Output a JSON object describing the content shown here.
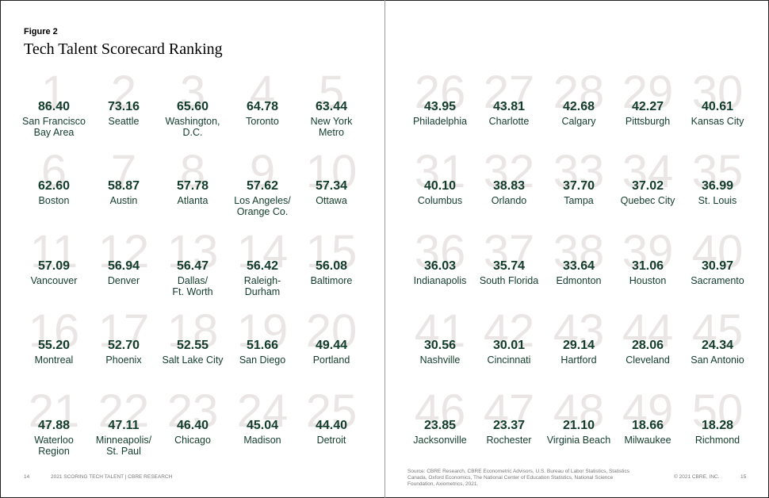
{
  "figure": {
    "label": "Figure 2",
    "title": "Tech Talent Scorecard Ranking"
  },
  "left_page": [
    {
      "rank": "1",
      "score": "86.40",
      "city": [
        "San Francisco",
        "Bay Area"
      ]
    },
    {
      "rank": "2",
      "score": "73.16",
      "city": [
        "Seattle"
      ]
    },
    {
      "rank": "3",
      "score": "65.60",
      "city": [
        "Washington,",
        "D.C."
      ]
    },
    {
      "rank": "4",
      "score": "64.78",
      "city": [
        "Toronto"
      ]
    },
    {
      "rank": "5",
      "score": "63.44",
      "city": [
        "New York Metro"
      ]
    },
    {
      "rank": "6",
      "score": "62.60",
      "city": [
        "Boston"
      ]
    },
    {
      "rank": "7",
      "score": "58.87",
      "city": [
        "Austin"
      ]
    },
    {
      "rank": "8",
      "score": "57.78",
      "city": [
        "Atlanta"
      ]
    },
    {
      "rank": "9",
      "score": "57.62",
      "city": [
        "Los Angeles/",
        "Orange Co."
      ]
    },
    {
      "rank": "10",
      "score": "57.34",
      "city": [
        "Ottawa"
      ]
    },
    {
      "rank": "11",
      "score": "57.09",
      "city": [
        "Vancouver"
      ]
    },
    {
      "rank": "12",
      "score": "56.94",
      "city": [
        "Denver"
      ]
    },
    {
      "rank": "13",
      "score": "56.47",
      "city": [
        "Dallas/",
        "Ft. Worth"
      ]
    },
    {
      "rank": "14",
      "score": "56.42",
      "city": [
        "Raleigh-Durham"
      ]
    },
    {
      "rank": "15",
      "score": "56.08",
      "city": [
        "Baltimore"
      ]
    },
    {
      "rank": "16",
      "score": "55.20",
      "city": [
        "Montreal"
      ]
    },
    {
      "rank": "17",
      "score": "52.70",
      "city": [
        "Phoenix"
      ]
    },
    {
      "rank": "18",
      "score": "52.55",
      "city": [
        "Salt Lake City"
      ]
    },
    {
      "rank": "19",
      "score": "51.66",
      "city": [
        "San Diego"
      ]
    },
    {
      "rank": "20",
      "score": "49.44",
      "city": [
        "Portland"
      ]
    },
    {
      "rank": "21",
      "score": "47.88",
      "city": [
        "Waterloo",
        "Region"
      ]
    },
    {
      "rank": "22",
      "score": "47.11",
      "city": [
        "Minneapolis/",
        "St. Paul"
      ]
    },
    {
      "rank": "23",
      "score": "46.40",
      "city": [
        "Chicago"
      ]
    },
    {
      "rank": "24",
      "score": "45.04",
      "city": [
        "Madison"
      ]
    },
    {
      "rank": "25",
      "score": "44.40",
      "city": [
        "Detroit"
      ]
    }
  ],
  "right_page": [
    {
      "rank": "26",
      "score": "43.95",
      "city": [
        "Philadelphia"
      ]
    },
    {
      "rank": "27",
      "score": "43.81",
      "city": [
        "Charlotte"
      ]
    },
    {
      "rank": "28",
      "score": "42.68",
      "city": [
        "Calgary"
      ]
    },
    {
      "rank": "29",
      "score": "42.27",
      "city": [
        "Pittsburgh"
      ]
    },
    {
      "rank": "30",
      "score": "40.61",
      "city": [
        "Kansas City"
      ]
    },
    {
      "rank": "31",
      "score": "40.10",
      "city": [
        "Columbus"
      ]
    },
    {
      "rank": "32",
      "score": "38.83",
      "city": [
        "Orlando"
      ]
    },
    {
      "rank": "33",
      "score": "37.70",
      "city": [
        "Tampa"
      ]
    },
    {
      "rank": "34",
      "score": "37.02",
      "city": [
        "Quebec City"
      ]
    },
    {
      "rank": "35",
      "score": "36.99",
      "city": [
        "St. Louis"
      ]
    },
    {
      "rank": "36",
      "score": "36.03",
      "city": [
        "Indianapolis"
      ]
    },
    {
      "rank": "37",
      "score": "35.74",
      "city": [
        "South Florida"
      ]
    },
    {
      "rank": "38",
      "score": "33.64",
      "city": [
        "Edmonton"
      ]
    },
    {
      "rank": "39",
      "score": "31.06",
      "city": [
        "Houston"
      ]
    },
    {
      "rank": "40",
      "score": "30.97",
      "city": [
        "Sacramento"
      ]
    },
    {
      "rank": "41",
      "score": "30.56",
      "city": [
        "Nashville"
      ]
    },
    {
      "rank": "42",
      "score": "30.01",
      "city": [
        "Cincinnati"
      ]
    },
    {
      "rank": "43",
      "score": "29.14",
      "city": [
        "Hartford"
      ]
    },
    {
      "rank": "44",
      "score": "28.06",
      "city": [
        "Cleveland"
      ]
    },
    {
      "rank": "45",
      "score": "24.34",
      "city": [
        "San Antonio"
      ]
    },
    {
      "rank": "46",
      "score": "23.85",
      "city": [
        "Jacksonville"
      ]
    },
    {
      "rank": "47",
      "score": "23.37",
      "city": [
        "Rochester"
      ]
    },
    {
      "rank": "48",
      "score": "21.10",
      "city": [
        "Virginia Beach"
      ]
    },
    {
      "rank": "49",
      "score": "18.66",
      "city": [
        "Milwaukee"
      ]
    },
    {
      "rank": "50",
      "score": "18.28",
      "city": [
        "Richmond"
      ]
    }
  ],
  "footer": {
    "left_page_number": "14",
    "left_running_head": "2021 SCORING TECH TALENT | CBRE RESEARCH",
    "source": [
      "Source: CBRE Research, CBRE Econometric Advisors, U.S. Bureau of Labor Statistics, Statistics",
      "Canada, Oxford Economics, The National Center of Education Statistics, National Science",
      "Foundation, Axiometrics, 2021."
    ],
    "copyright": "© 2021 CBRE, INC.",
    "right_page_number": "15"
  }
}
